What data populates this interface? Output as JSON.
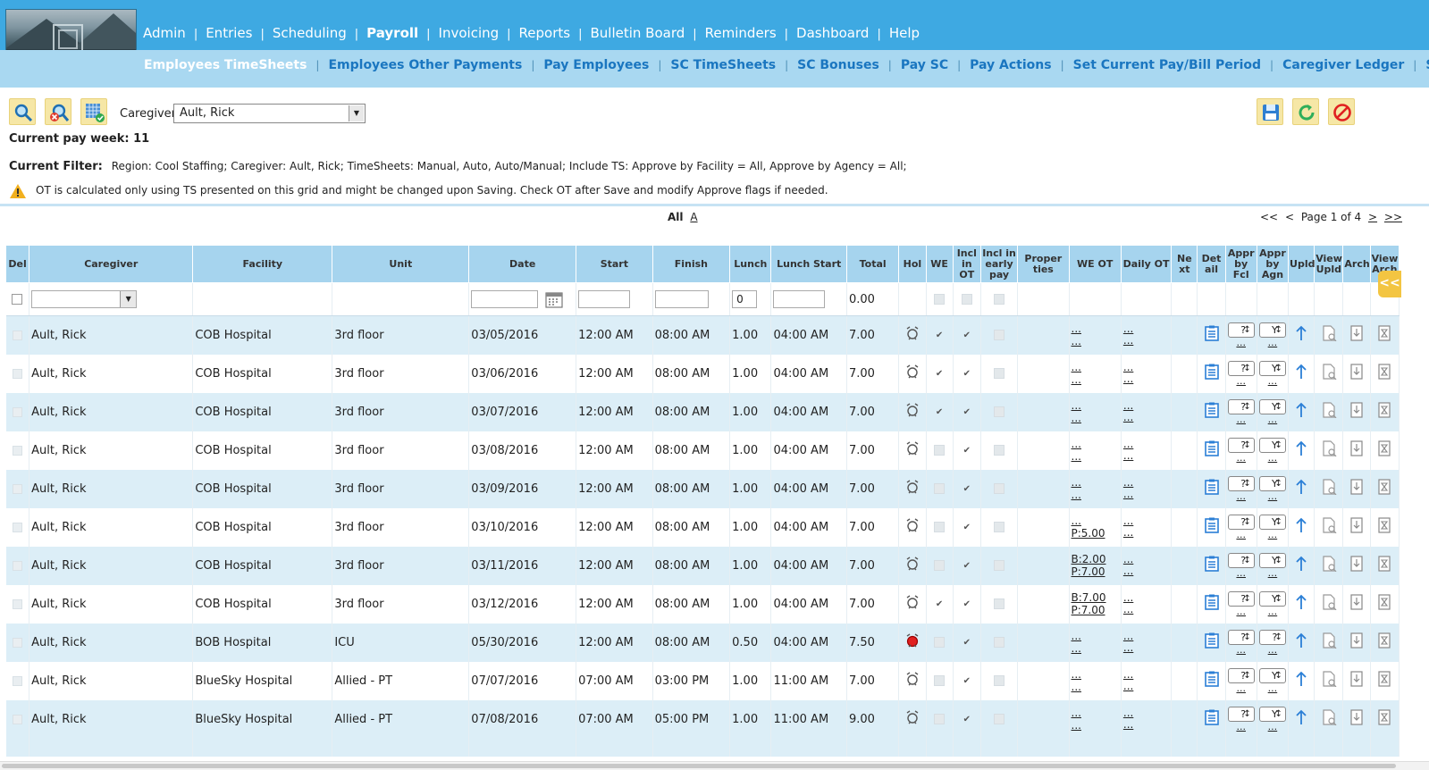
{
  "main_nav": [
    {
      "label": "Admin"
    },
    {
      "label": "Entries"
    },
    {
      "label": "Scheduling"
    },
    {
      "label": "Payroll",
      "active": true
    },
    {
      "label": "Invoicing"
    },
    {
      "label": "Reports"
    },
    {
      "label": "Bulletin Board"
    },
    {
      "label": "Reminders"
    },
    {
      "label": "Dashboard"
    },
    {
      "label": "Help"
    }
  ],
  "sub_nav": [
    {
      "label": "Employees TimeSheets",
      "active": true
    },
    {
      "label": "Employees Other Payments"
    },
    {
      "label": "Pay Employees"
    },
    {
      "label": "SC TimeSheets"
    },
    {
      "label": "SC Bonuses"
    },
    {
      "label": "Pay SC"
    },
    {
      "label": "Pay Actions"
    },
    {
      "label": "Set Current Pay/Bill Period"
    },
    {
      "label": "Caregiver Ledger"
    },
    {
      "label": "SC Ledge"
    }
  ],
  "toolbar": {
    "caregiver_label": "Caregiver",
    "caregiver_value": "Ault, Rick"
  },
  "pay_week": "Current pay week: 11",
  "filter": {
    "label": "Current Filter:",
    "text": "Region: Cool Staffing; Caregiver: Ault, Rick; TimeSheets: Manual, Auto, Auto/Manual; Include TS: Approve by Facility = All, Approve by Agency = All;"
  },
  "warning": "OT is calculated only using TS presented on this grid and might be changed upon Saving. Check OT after Save and modify Approve flags if needed.",
  "alpha": {
    "all": "All",
    "a": "A"
  },
  "pager": {
    "first": "<<",
    "prev": "<",
    "text": "Page 1 of 4",
    "next": ">",
    "last": ">>"
  },
  "collapse_label": "<<",
  "columns": [
    "Del",
    "Caregiver",
    "Facility",
    "Unit",
    "Date",
    "Start",
    "Finish",
    "Lunch",
    "Lunch Start",
    "Total",
    "Hol",
    "WE",
    "Incl in OT",
    "Incl in early pay",
    "Proper ties",
    "WE OT",
    "Daily OT",
    "Ne xt",
    "Det ail",
    "Appr by Fcl",
    "Appr by Agn",
    "Upld",
    "View Upld",
    "Arch",
    "View Arch"
  ],
  "filter_row": {
    "lunch": "0",
    "total": "0.00"
  },
  "rows": [
    {
      "caregiver": "Ault, Rick",
      "facility": "COB Hospital",
      "unit": "3rd floor",
      "date": "03/05/2016",
      "start": "12:00 AM",
      "finish": "08:00 AM",
      "lunch": "1.00",
      "lunch_start": "04:00 AM",
      "total": "7.00",
      "holiday": false,
      "we": true,
      "we_ot": [
        "...",
        "..."
      ],
      "daily_ot": [
        "...",
        "..."
      ],
      "fcl": "?",
      "agn": "Y"
    },
    {
      "caregiver": "Ault, Rick",
      "facility": "COB Hospital",
      "unit": "3rd floor",
      "date": "03/06/2016",
      "start": "12:00 AM",
      "finish": "08:00 AM",
      "lunch": "1.00",
      "lunch_start": "04:00 AM",
      "total": "7.00",
      "holiday": false,
      "we": true,
      "we_ot": [
        "...",
        "..."
      ],
      "daily_ot": [
        "...",
        "..."
      ],
      "fcl": "?",
      "agn": "Y"
    },
    {
      "caregiver": "Ault, Rick",
      "facility": "COB Hospital",
      "unit": "3rd floor",
      "date": "03/07/2016",
      "start": "12:00 AM",
      "finish": "08:00 AM",
      "lunch": "1.00",
      "lunch_start": "04:00 AM",
      "total": "7.00",
      "holiday": false,
      "we": true,
      "we_ot": [
        "...",
        "..."
      ],
      "daily_ot": [
        "...",
        "..."
      ],
      "fcl": "?",
      "agn": "Y"
    },
    {
      "caregiver": "Ault, Rick",
      "facility": "COB Hospital",
      "unit": "3rd floor",
      "date": "03/08/2016",
      "start": "12:00 AM",
      "finish": "08:00 AM",
      "lunch": "1.00",
      "lunch_start": "04:00 AM",
      "total": "7.00",
      "holiday": false,
      "we": false,
      "we_ot": [
        "...",
        "..."
      ],
      "daily_ot": [
        "...",
        "..."
      ],
      "fcl": "?",
      "agn": "Y"
    },
    {
      "caregiver": "Ault, Rick",
      "facility": "COB Hospital",
      "unit": "3rd floor",
      "date": "03/09/2016",
      "start": "12:00 AM",
      "finish": "08:00 AM",
      "lunch": "1.00",
      "lunch_start": "04:00 AM",
      "total": "7.00",
      "holiday": false,
      "we": false,
      "we_ot": [
        "...",
        "..."
      ],
      "daily_ot": [
        "...",
        "..."
      ],
      "fcl": "?",
      "agn": "Y"
    },
    {
      "caregiver": "Ault, Rick",
      "facility": "COB Hospital",
      "unit": "3rd floor",
      "date": "03/10/2016",
      "start": "12:00 AM",
      "finish": "08:00 AM",
      "lunch": "1.00",
      "lunch_start": "04:00 AM",
      "total": "7.00",
      "holiday": false,
      "we": false,
      "we_ot": [
        "...",
        "P:5.00"
      ],
      "daily_ot": [
        "...",
        "..."
      ],
      "fcl": "?",
      "agn": "Y"
    },
    {
      "caregiver": "Ault, Rick",
      "facility": "COB Hospital",
      "unit": "3rd floor",
      "date": "03/11/2016",
      "start": "12:00 AM",
      "finish": "08:00 AM",
      "lunch": "1.00",
      "lunch_start": "04:00 AM",
      "total": "7.00",
      "holiday": false,
      "we": false,
      "we_ot": [
        "B:2.00",
        "P:7.00"
      ],
      "daily_ot": [
        "...",
        "..."
      ],
      "fcl": "?",
      "agn": "Y"
    },
    {
      "caregiver": "Ault, Rick",
      "facility": "COB Hospital",
      "unit": "3rd floor",
      "date": "03/12/2016",
      "start": "12:00 AM",
      "finish": "08:00 AM",
      "lunch": "1.00",
      "lunch_start": "04:00 AM",
      "total": "7.00",
      "holiday": false,
      "we": true,
      "we_ot": [
        "B:7.00",
        "P:7.00"
      ],
      "daily_ot": [
        "...",
        "..."
      ],
      "fcl": "?",
      "agn": "Y"
    },
    {
      "caregiver": "Ault, Rick",
      "facility": "BOB Hospital",
      "unit": "ICU",
      "date": "05/30/2016",
      "start": "12:00 AM",
      "finish": "08:00 AM",
      "lunch": "0.50",
      "lunch_start": "04:00 AM",
      "total": "7.50",
      "holiday": true,
      "we": false,
      "we_ot": [
        "...",
        "..."
      ],
      "daily_ot": [
        "...",
        "..."
      ],
      "fcl": "?",
      "agn": "?"
    },
    {
      "caregiver": "Ault, Rick",
      "facility": "BlueSky Hospital",
      "unit": "Allied - PT",
      "date": "07/07/2016",
      "start": "07:00 AM",
      "finish": "03:00 PM",
      "lunch": "1.00",
      "lunch_start": "11:00 AM",
      "total": "7.00",
      "holiday": false,
      "we": false,
      "we_ot": [
        "...",
        "..."
      ],
      "daily_ot": [
        "...",
        "..."
      ],
      "fcl": "?",
      "agn": "Y"
    },
    {
      "caregiver": "Ault, Rick",
      "facility": "BlueSky Hospital",
      "unit": "Allied - PT",
      "date": "07/08/2016",
      "start": "07:00 AM",
      "finish": "05:00 PM",
      "lunch": "1.00",
      "lunch_start": "11:00 AM",
      "total": "9.00",
      "holiday": false,
      "we": false,
      "we_ot": [
        "...",
        "..."
      ],
      "daily_ot": [
        "...",
        "..."
      ],
      "fcl": "?",
      "agn": "Y"
    }
  ],
  "colors": {
    "header": "#3ea9e2",
    "subnav": "#a9d8f1",
    "grid_header": "#a6d4ee",
    "row_alt": "#dceef7",
    "link": "#1a76c0"
  }
}
